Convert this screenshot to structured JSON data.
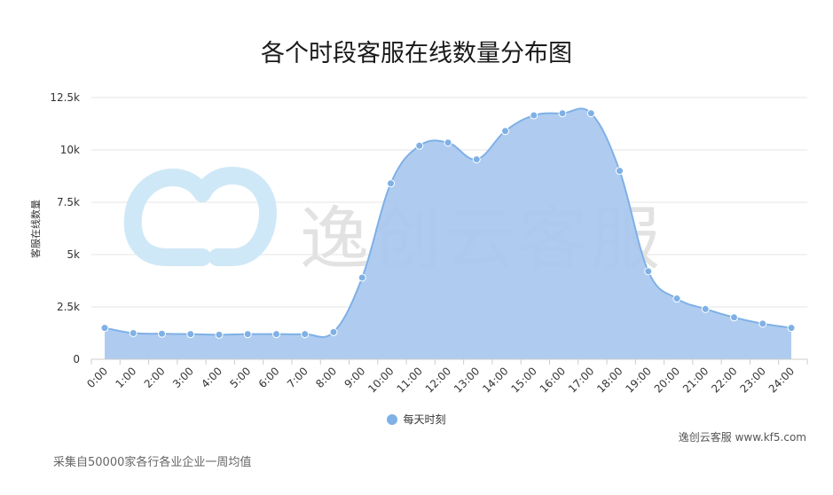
{
  "chart_data": {
    "type": "area",
    "title": "各个时段客服在线数量分布图",
    "xlabel": "",
    "ylabel": "客服在线数量",
    "x": [
      "0:00",
      "1:00",
      "2:00",
      "3:00",
      "4:00",
      "5:00",
      "6:00",
      "7:00",
      "8:00",
      "9:00",
      "10:00",
      "11:00",
      "12:00",
      "13:00",
      "14:00",
      "15:00",
      "16:00",
      "17:00",
      "18:00",
      "19:00",
      "20:00",
      "21:00",
      "22:00",
      "23:00",
      "24:00"
    ],
    "series": [
      {
        "name": "每天时刻",
        "values": [
          1500,
          1250,
          1220,
          1200,
          1170,
          1200,
          1200,
          1200,
          1300,
          3900,
          8400,
          10200,
          10350,
          9550,
          10900,
          11650,
          11750,
          11750,
          9000,
          4200,
          2900,
          2400,
          2000,
          1700,
          1500
        ]
      }
    ],
    "ylim": [
      0,
      12500
    ],
    "yticks": [
      0,
      2500,
      5000,
      7500,
      10000,
      12500
    ],
    "ytick_labels": [
      "0",
      "2.5k",
      "5k",
      "7.5k",
      "10k",
      "12.5k"
    ],
    "grid": true,
    "legend": "bottom-center",
    "colors": {
      "area": "#a8c8ef",
      "line": "#7fb0e6",
      "point": "#7fb0e6",
      "grid": "#e6e6e6",
      "watermark": "#cfe8f7"
    }
  },
  "watermark_text": "逸创云客服",
  "credit_text": "逸创云客服 www.kf5.com",
  "source_note": "采集自50000家各行各业企业一周均值"
}
